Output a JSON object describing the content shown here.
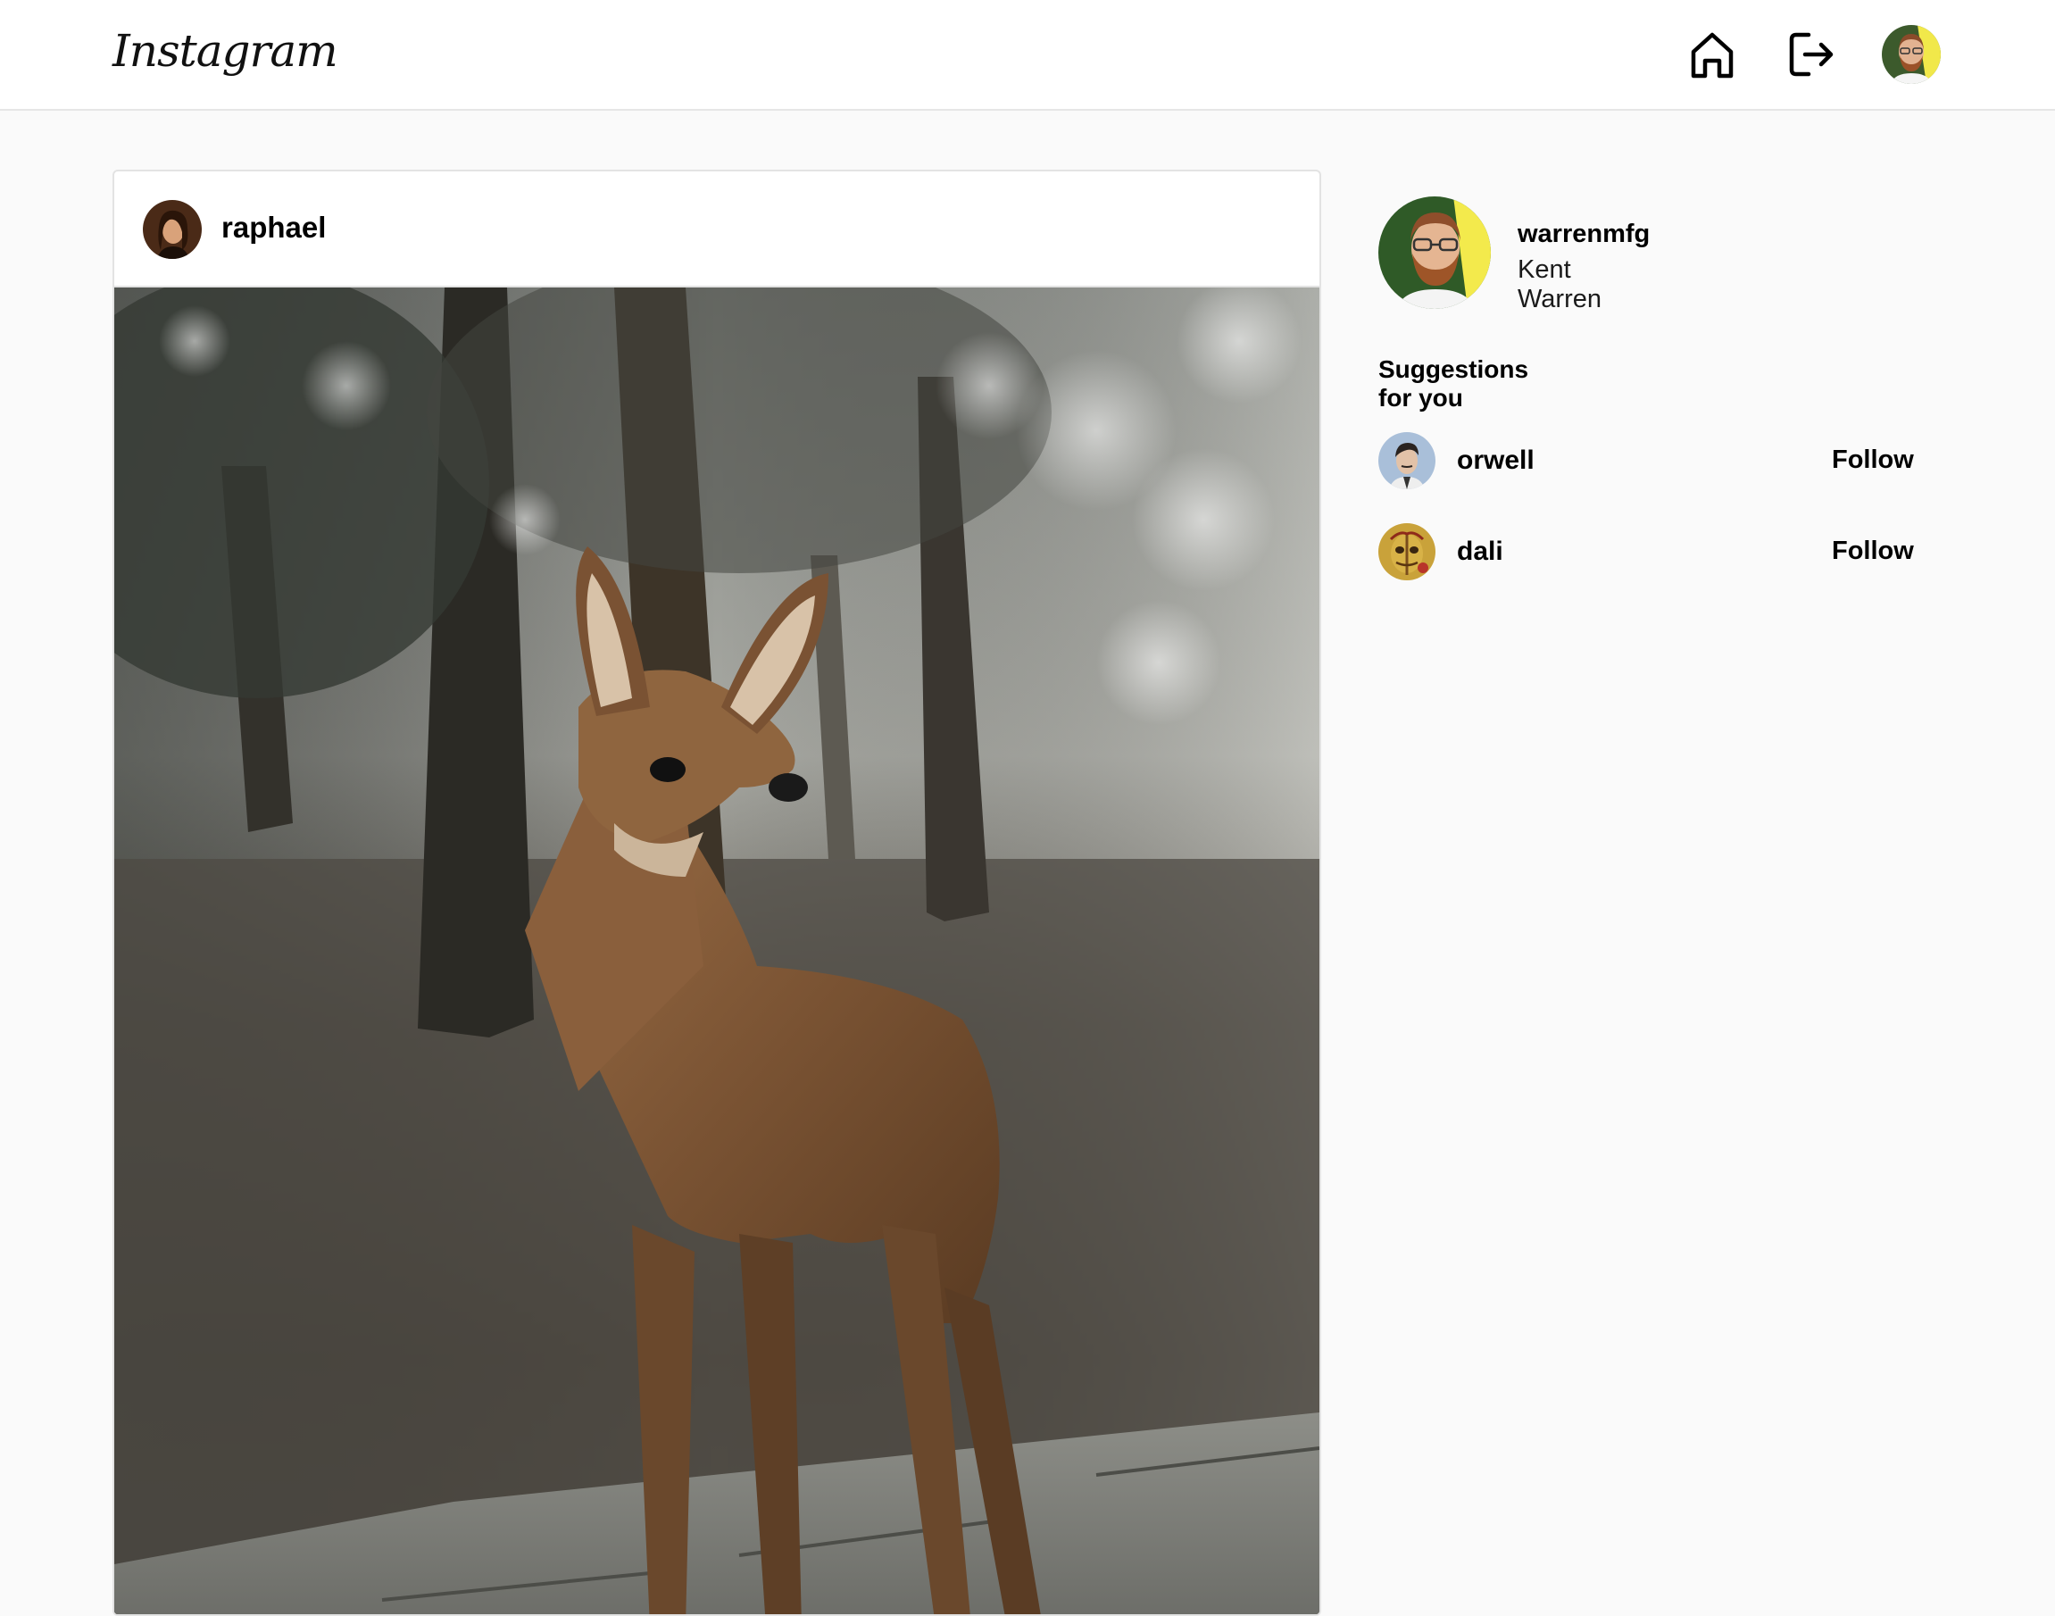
{
  "header": {
    "logo_text": "Instagram",
    "home_icon": "home-icon",
    "logout_icon": "sign-out-icon",
    "avatar_icon": "user-avatar"
  },
  "post": {
    "username": "raphael",
    "image_subject": "deer-in-forest-photo"
  },
  "sidebar": {
    "user": {
      "username": "warrenmfg",
      "full_name": "Kent Warren"
    },
    "suggestions_title": "Suggestions for you",
    "suggestions": [
      {
        "username": "orwell",
        "action_label": "Follow"
      },
      {
        "username": "dali",
        "action_label": "Follow"
      }
    ]
  },
  "colors": {
    "page_background": "#fafafa",
    "card_background": "#ffffff",
    "border": "#e3e3e3",
    "text": "#000000"
  }
}
